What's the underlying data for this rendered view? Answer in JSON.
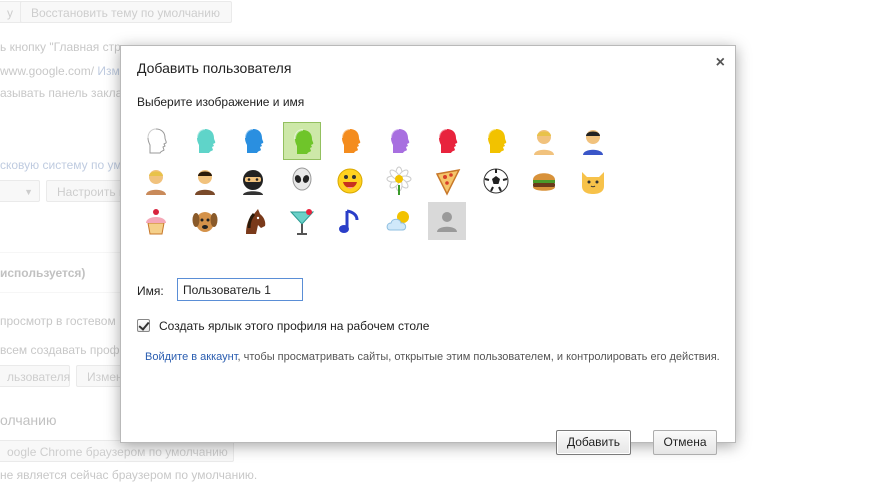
{
  "background": {
    "reset_theme_button": "Восстановить тему по умолчанию",
    "cut_button": "у",
    "line_home": "ь кнопку \"Главная стр",
    "home_url": "www.google.com/",
    "home_change": "Измен",
    "line_bookmarks": "азывать панель заклад",
    "search_link": "сковую систему по ум",
    "configure_button": "Настроить п",
    "section_used": "используется)",
    "guest_line": "просмотр в гостевом",
    "all_line": "всем создавать профи",
    "add_user_btn": "льзователя",
    "change_btn": "Измен",
    "default_heading": "олчанию",
    "default_browser_btn": "oogle Chrome браузером по умолчанию",
    "not_default_line": "не является сейчас браузером по умолчанию."
  },
  "dialog": {
    "title": "Добавить пользователя",
    "close_label": "×",
    "subtitle": "Выберите изображение и имя",
    "avatars": [
      {
        "name": "avatar-white-head",
        "kind": "head",
        "color": "#ffffff",
        "selected": false
      },
      {
        "name": "avatar-teal-head",
        "kind": "head",
        "color": "#5fd4c9",
        "selected": false
      },
      {
        "name": "avatar-blue-head",
        "kind": "head",
        "color": "#2a8fe0",
        "selected": false
      },
      {
        "name": "avatar-green-head",
        "kind": "head",
        "color": "#6fc52a",
        "selected": true
      },
      {
        "name": "avatar-orange-head",
        "kind": "head",
        "color": "#f48c1e",
        "selected": false
      },
      {
        "name": "avatar-purple-head",
        "kind": "head",
        "color": "#a86fe0",
        "selected": false
      },
      {
        "name": "avatar-red-head",
        "kind": "head",
        "color": "#e8233d",
        "selected": false
      },
      {
        "name": "avatar-yellow-head",
        "kind": "head",
        "color": "#f2c200",
        "selected": false
      },
      {
        "name": "avatar-businesswoman",
        "kind": "person",
        "color": "#f1c27d",
        "selected": false
      },
      {
        "name": "avatar-superhero",
        "kind": "person",
        "color": "#3a56c8",
        "selected": false
      },
      {
        "name": "avatar-woman-sunglasses",
        "kind": "person",
        "color": "#c98a5a",
        "selected": false
      },
      {
        "name": "avatar-man",
        "kind": "person",
        "color": "#7a4a2a",
        "selected": false
      },
      {
        "name": "avatar-ninja",
        "kind": "ninja",
        "color": "#222222",
        "selected": false
      },
      {
        "name": "avatar-alien",
        "kind": "alien",
        "color": "#e0e0e0",
        "selected": false
      },
      {
        "name": "avatar-smiley",
        "kind": "smiley",
        "color": "#ffd21f",
        "selected": false
      },
      {
        "name": "avatar-flower",
        "kind": "flower",
        "color": "#ffffff",
        "selected": false
      },
      {
        "name": "avatar-pizza",
        "kind": "pizza",
        "color": "#f5c56a",
        "selected": false
      },
      {
        "name": "avatar-soccer-ball",
        "kind": "ball",
        "color": "#ffffff",
        "selected": false
      },
      {
        "name": "avatar-burger",
        "kind": "burger",
        "color": "#c8782a",
        "selected": false
      },
      {
        "name": "avatar-cat",
        "kind": "cat",
        "color": "#f7c24a",
        "selected": false
      },
      {
        "name": "avatar-cupcake",
        "kind": "cupcake",
        "color": "#f5a8b8",
        "selected": false
      },
      {
        "name": "avatar-dog",
        "kind": "dog",
        "color": "#d4924a",
        "selected": false
      },
      {
        "name": "avatar-horse",
        "kind": "horse",
        "color": "#7a3a1a",
        "selected": false
      },
      {
        "name": "avatar-cocktail",
        "kind": "cocktail",
        "color": "#6ad0c8",
        "selected": false
      },
      {
        "name": "avatar-music-note",
        "kind": "note",
        "color": "#2a3ec8",
        "selected": false
      },
      {
        "name": "avatar-sun-cloud",
        "kind": "cloud",
        "color": "#9fd0f2",
        "selected": false
      },
      {
        "name": "avatar-generic-placeholder",
        "kind": "placeholder",
        "color": "#9a9a9a",
        "selected": false
      }
    ],
    "name_label": "Имя:",
    "name_value": "Пользователь 1",
    "shortcut_label": "Создать ярлык этого профиля на рабочем столе",
    "shortcut_checked": true,
    "signin_link": "Войдите в аккаунт",
    "signin_text": ", чтобы просматривать сайты, открытые этим пользователем, и контролировать его действия.",
    "add_button": "Добавить",
    "cancel_button": "Отмена"
  }
}
